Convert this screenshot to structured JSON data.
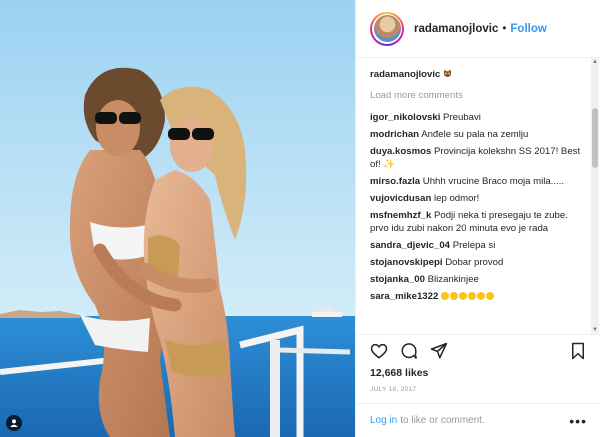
{
  "photo": {
    "alt_icon": "user-tag-icon"
  },
  "header": {
    "username": "radamanojlovic",
    "separator": "•",
    "follow": "Follow"
  },
  "caption": {
    "username": "radamanojlovic",
    "emoji": "cat-face-icon"
  },
  "load_more": "Load more comments",
  "comments": [
    {
      "user": "igor_nikolovski",
      "text": "Preubavi"
    },
    {
      "user": "modrichan",
      "text": "Anđele su pala na zemlju"
    },
    {
      "user": "duya.kosmos",
      "text": "Provincija kolekshn SS 2017! Best of!"
    },
    {
      "user": "mirso.fazla",
      "text": "Uhhh vrucine Braco moja mila....."
    },
    {
      "user": "vujovicdusan",
      "text": "lep odmor!"
    },
    {
      "user": "msfnemhzf_k",
      "text": "Podji neka ti presegaju te zube. prvo idu zubi nakon 20 minuta evo je rada"
    },
    {
      "user": "sandra_djevic_04",
      "text": "Prelepa si"
    },
    {
      "user": "stojanovskipepi",
      "text": "Dobar provod"
    },
    {
      "user": "stojanka_00",
      "text": "Blizankinjee"
    },
    {
      "user": "sara_mike1322",
      "text": ""
    }
  ],
  "actions": {
    "likes": "12,668 likes",
    "date": "JULY 18, 2017"
  },
  "footer": {
    "login": "Log in",
    "rest": "to like or comment.",
    "more": "•••"
  },
  "colors": {
    "link": "#3897f0",
    "muted": "#999999",
    "text": "#262626",
    "sea": "#2a86d4"
  }
}
